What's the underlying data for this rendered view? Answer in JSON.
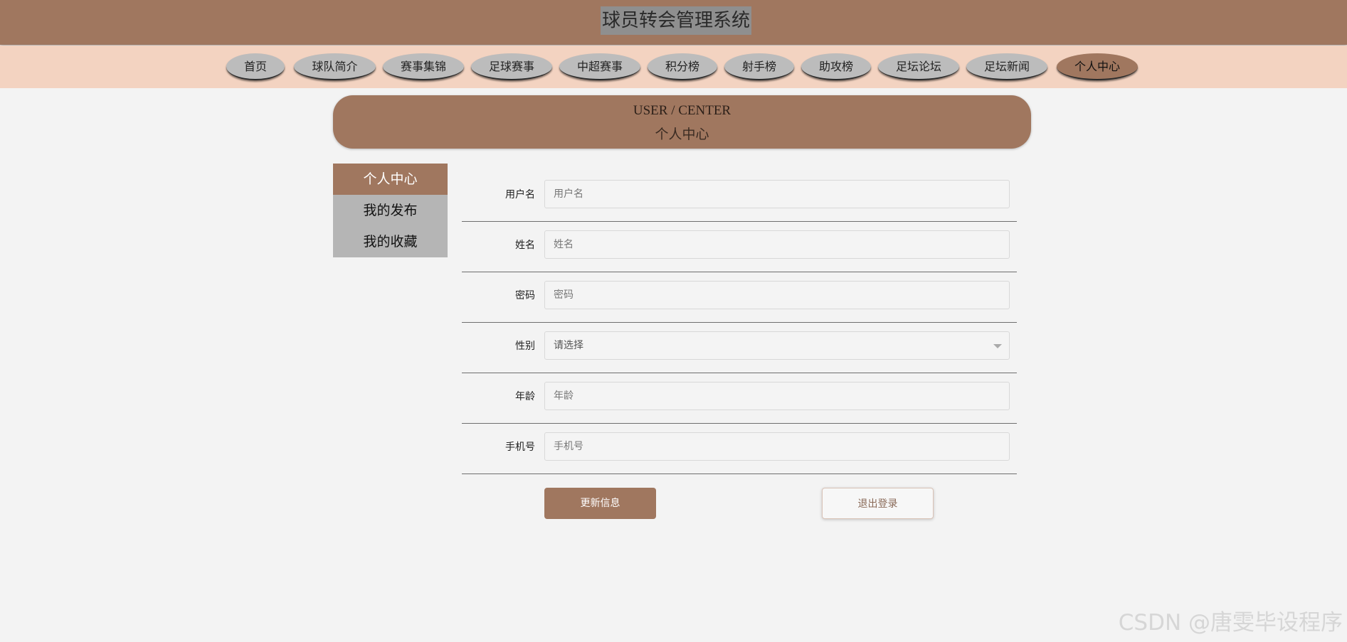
{
  "header": {
    "title": "球员转会管理系统"
  },
  "nav": {
    "items": [
      "首页",
      "球队简介",
      "赛事集锦",
      "足球赛事",
      "中超赛事",
      "积分榜",
      "射手榜",
      "助攻榜",
      "足坛论坛",
      "足坛新闻",
      "个人中心"
    ],
    "active": "个人中心"
  },
  "banner": {
    "en": "USER / CENTER",
    "zh": "个人中心"
  },
  "sidebar": {
    "items": [
      "个人中心",
      "我的发布",
      "我的收藏"
    ],
    "active": "个人中心"
  },
  "form": {
    "username": {
      "label": "用户名",
      "placeholder": "用户名",
      "value": ""
    },
    "name": {
      "label": "姓名",
      "placeholder": "姓名",
      "value": ""
    },
    "password": {
      "label": "密码",
      "placeholder": "密码",
      "value": ""
    },
    "gender": {
      "label": "性别",
      "selected": "请选择"
    },
    "age": {
      "label": "年龄",
      "placeholder": "年龄",
      "value": ""
    },
    "phone": {
      "label": "手机号",
      "placeholder": "手机号",
      "value": ""
    }
  },
  "buttons": {
    "update": "更新信息",
    "logout": "退出登录"
  },
  "watermark": "CSDN @唐雯毕设程序",
  "colors": {
    "primary": "#a0775f",
    "nav_bg": "#f3d3c1",
    "page_bg": "#f3f3f3"
  }
}
